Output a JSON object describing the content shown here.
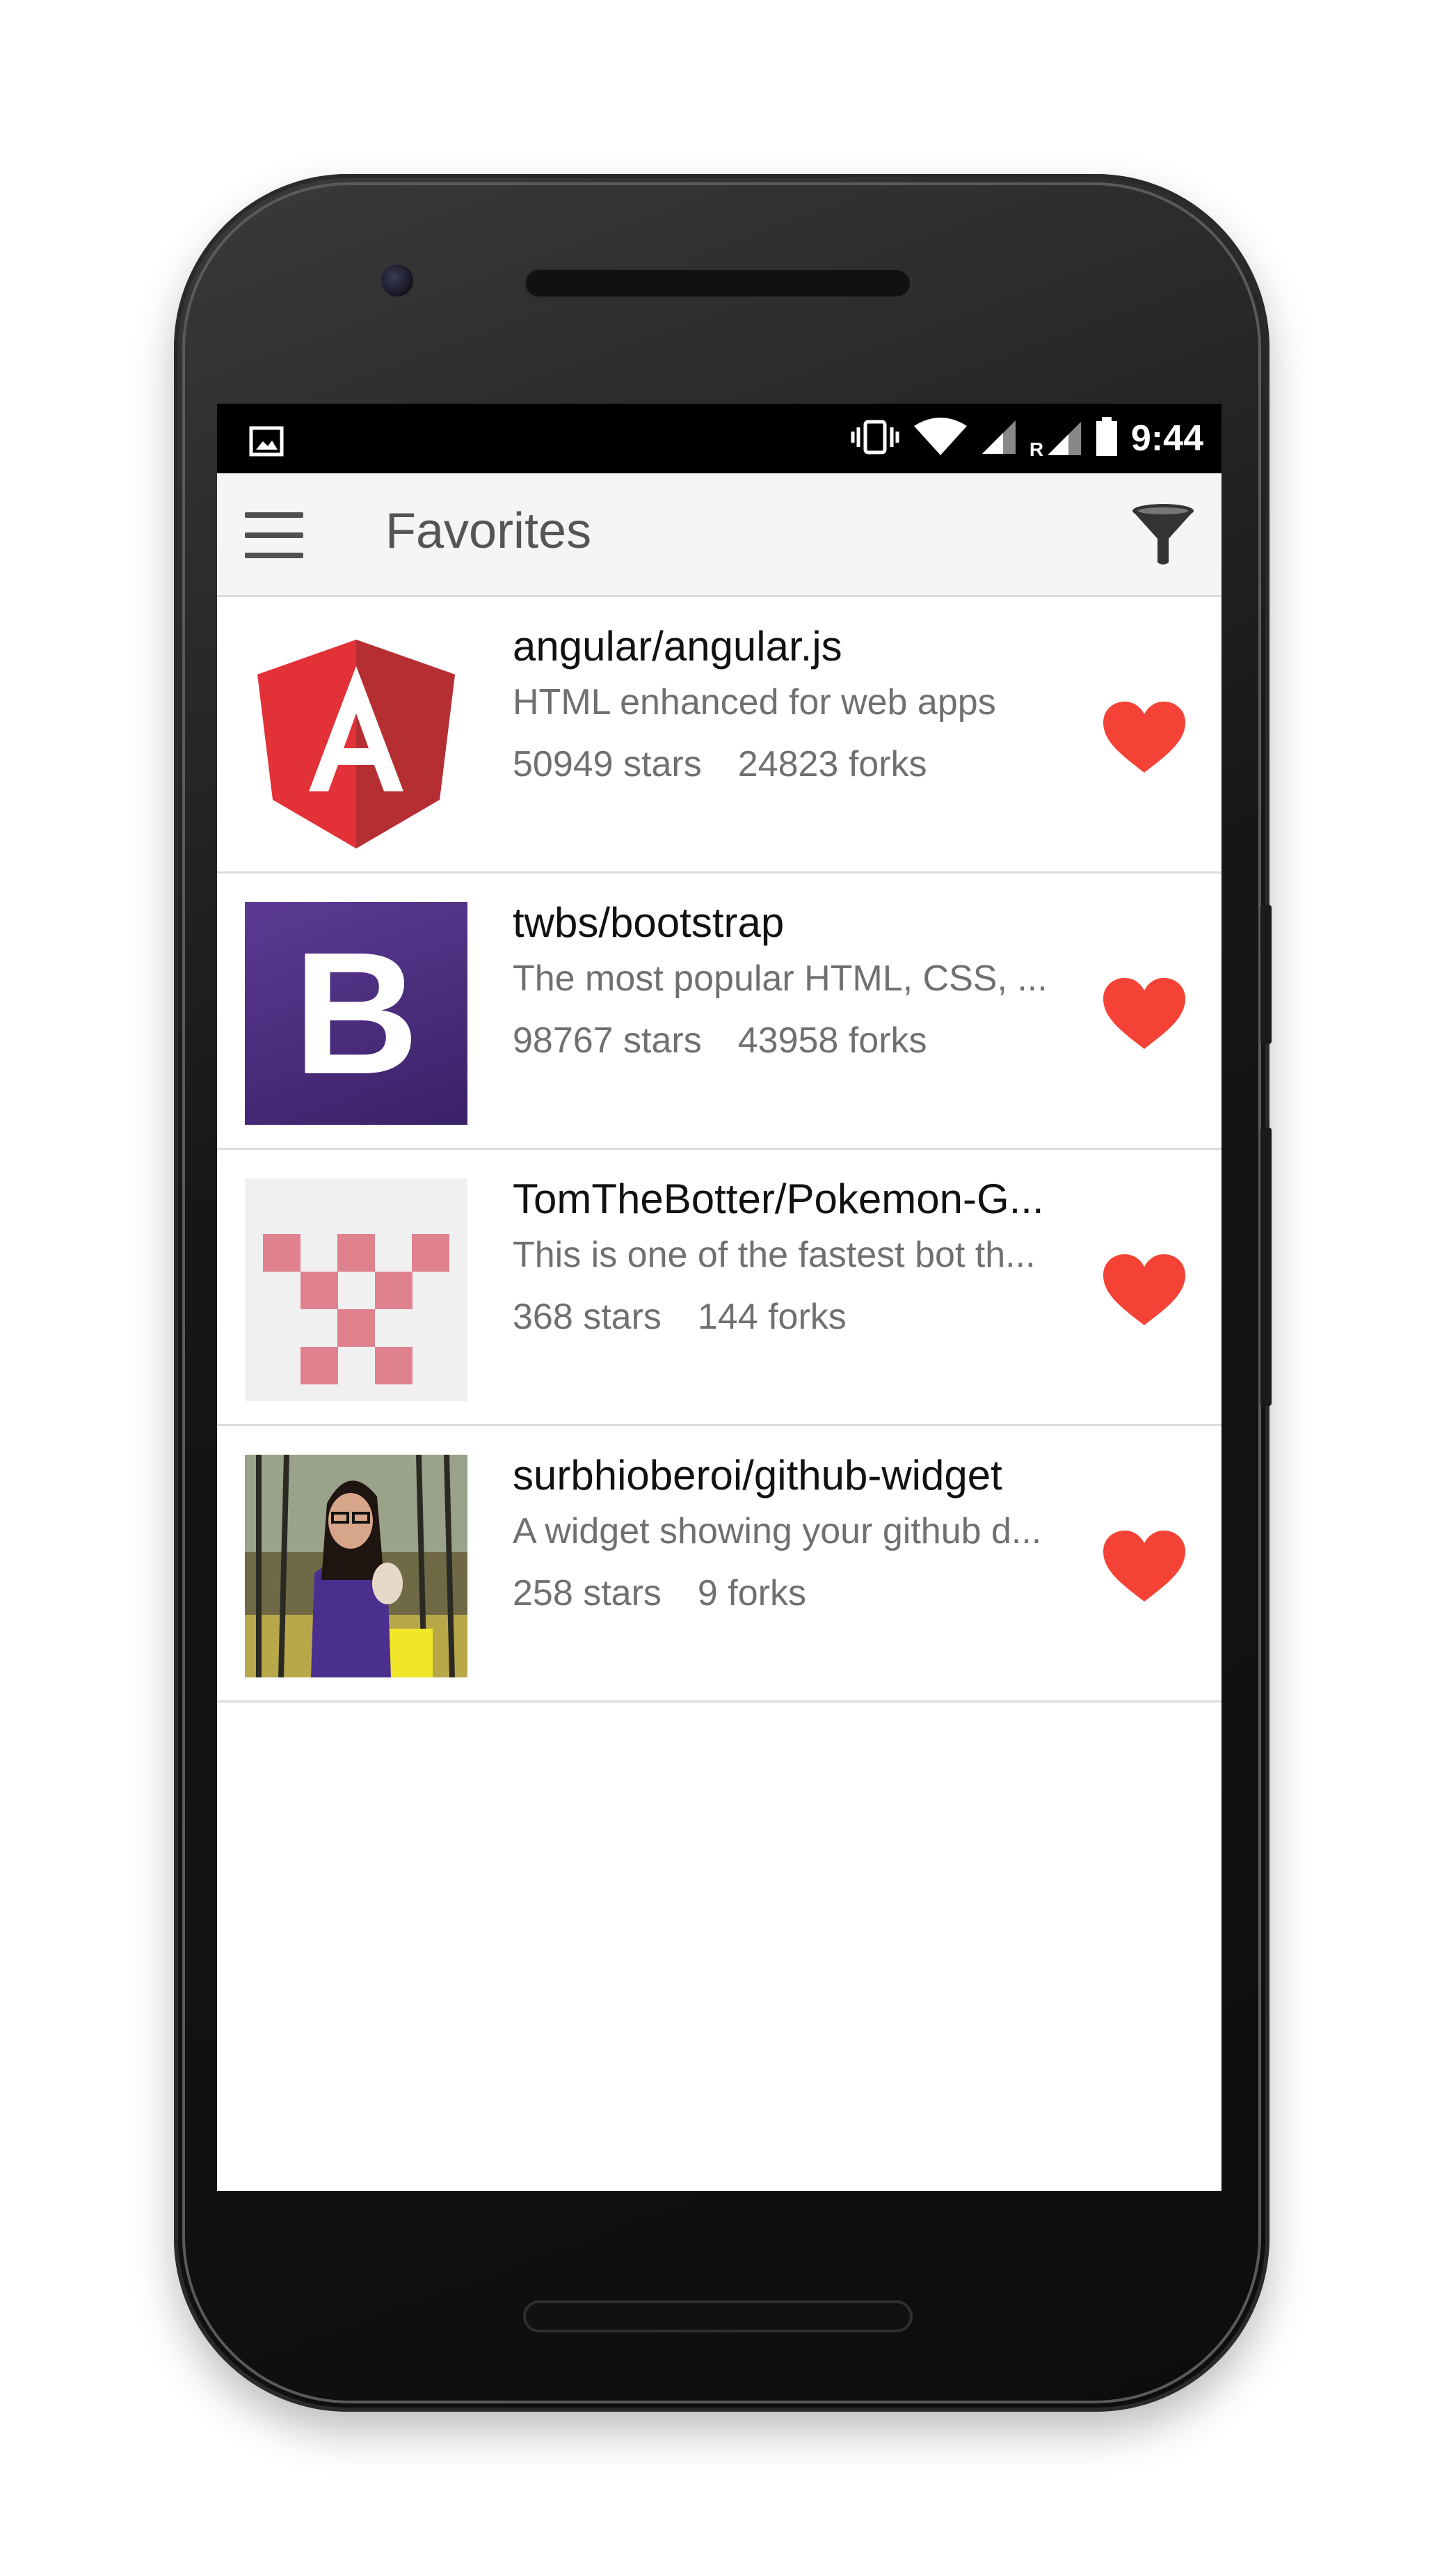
{
  "status_bar": {
    "time": "9:44",
    "network_label": "R",
    "icons": [
      "image-icon",
      "vibrate-icon",
      "wifi-icon",
      "signal-icon",
      "signal-roaming-icon",
      "battery-icon"
    ]
  },
  "app_bar": {
    "title": "Favorites",
    "menu_icon": "hamburger-menu-icon",
    "filter_icon": "filter-funnel-icon"
  },
  "colors": {
    "heart": "#f44336",
    "app_bar_bg": "#f5f5f5",
    "status_bar_bg": "#000000",
    "bootstrap_purple": "#4b2d7f",
    "angular_red": "#dd3339",
    "identicon_pink": "#e0818e"
  },
  "repos": [
    {
      "title": "angular/angular.js",
      "description": "HTML enhanced for web apps",
      "stars": "50949 stars",
      "forks": "24823 forks",
      "icon": "angular-logo",
      "favorited": true
    },
    {
      "title": "twbs/bootstrap",
      "description": "The most popular HTML, CSS, ...",
      "stars": "98767 stars",
      "forks": "43958 forks",
      "icon": "bootstrap-logo",
      "logo_letter": "B",
      "favorited": true
    },
    {
      "title": "TomTheBotter/Pokemon-G...",
      "description": "This is one of the fastest bot th...",
      "stars": "368 stars",
      "forks": "144 forks",
      "icon": "identicon-avatar",
      "favorited": true
    },
    {
      "title": "surbhioberoi/github-widget",
      "description": "A widget showing your github d...",
      "stars": "258 stars",
      "forks": "9 forks",
      "icon": "user-photo-avatar",
      "favorited": true
    }
  ]
}
